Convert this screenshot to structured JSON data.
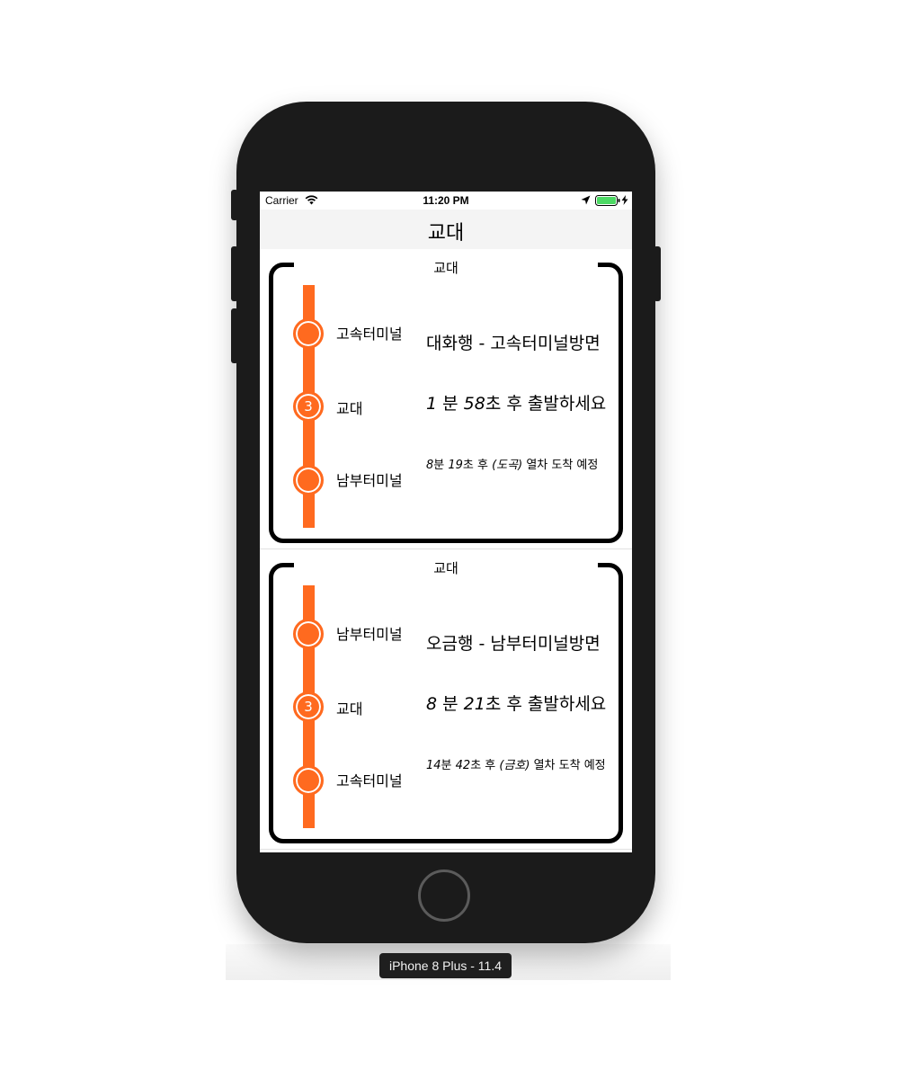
{
  "simulator": {
    "device_label": "iPhone 8 Plus - 11.4"
  },
  "status_bar": {
    "carrier": "Carrier",
    "time": "11:20 PM",
    "icons": [
      "wifi-icon",
      "location-arrow-icon",
      "battery-icon",
      "charging-bolt-icon"
    ],
    "battery_color": "#4cd964"
  },
  "nav": {
    "title": "교대"
  },
  "accent_color": "#ff6a1f",
  "cards": [
    {
      "title": "교대",
      "stations": [
        {
          "label": "고속터미널",
          "marker": ""
        },
        {
          "label": "교대",
          "marker": "3"
        },
        {
          "label": "남부터미널",
          "marker": ""
        }
      ],
      "direction": "대화행 - 고속터미널방면",
      "depart": {
        "min": "1",
        "min_unit": " 분 ",
        "sec": "58",
        "suffix": "초 후 출발하세요"
      },
      "arrival": {
        "min": "8",
        "min_unit": "분 ",
        "sec": "19",
        "sec_unit": "초 후 ",
        "dest": "(도곡)",
        "suffix": " 열차 도착 예정"
      }
    },
    {
      "title": "교대",
      "stations": [
        {
          "label": "남부터미널",
          "marker": ""
        },
        {
          "label": "교대",
          "marker": "3"
        },
        {
          "label": "고속터미널",
          "marker": ""
        }
      ],
      "direction": "오금행 - 남부터미널방면",
      "depart": {
        "min": "8",
        "min_unit": " 분 ",
        "sec": "21",
        "suffix": "초 후 출발하세요"
      },
      "arrival": {
        "min": "14",
        "min_unit": "분 ",
        "sec": "42",
        "sec_unit": "초 후 ",
        "dest": "(금호)",
        "suffix": " 열차 도착 예정"
      }
    }
  ]
}
